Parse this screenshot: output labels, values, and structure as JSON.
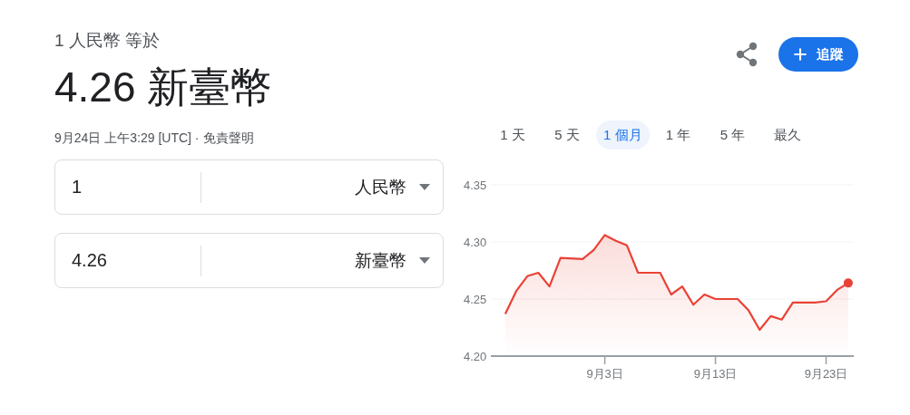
{
  "header": {
    "subtitle": "1 人民幣 等於",
    "amount": "4.26 新臺幣",
    "timestamp": "9月24日 上午3:29 [UTC] ·",
    "disclaimer": "免責聲明"
  },
  "follow_button": {
    "label": "追蹤"
  },
  "converter": [
    {
      "amount": "1",
      "currency": "人民幣"
    },
    {
      "amount": "4.26",
      "currency": "新臺幣"
    }
  ],
  "ranges": [
    {
      "label": "1 天",
      "selected": false
    },
    {
      "label": "5 天",
      "selected": false
    },
    {
      "label": "1 個月",
      "selected": true
    },
    {
      "label": "1 年",
      "selected": false
    },
    {
      "label": "5 年",
      "selected": false
    },
    {
      "label": "最久",
      "selected": false
    }
  ],
  "chart": {
    "chart_data": {
      "type": "area",
      "categories": [
        null,
        null,
        null,
        null,
        null,
        null,
        null,
        null,
        null,
        "9月3日",
        null,
        null,
        null,
        null,
        null,
        null,
        null,
        null,
        null,
        "9月13日",
        null,
        null,
        null,
        null,
        null,
        null,
        null,
        null,
        null,
        "9月23日",
        null,
        null
      ],
      "series": [
        {
          "color": "#e94235",
          "values": [
            4.237,
            4.257,
            4.27,
            4.273,
            4.261,
            4.286,
            null,
            4.285,
            4.293,
            4.306,
            4.301,
            4.297,
            4.273,
            null,
            4.273,
            4.254,
            4.261,
            4.245,
            4.254,
            4.25,
            null,
            4.25,
            4.24,
            4.223,
            4.235,
            4.232,
            4.247,
            null,
            4.247,
            4.248,
            4.258,
            4.264
          ]
        }
      ],
      "ylim": [
        4.2,
        4.35
      ],
      "yticks": [
        {
          "value": 4.2,
          "label": "4.20"
        },
        {
          "value": 4.25,
          "label": "4.25"
        },
        {
          "value": 4.3,
          "label": "4.30"
        },
        {
          "value": 4.35,
          "label": "4.35"
        }
      ]
    }
  }
}
